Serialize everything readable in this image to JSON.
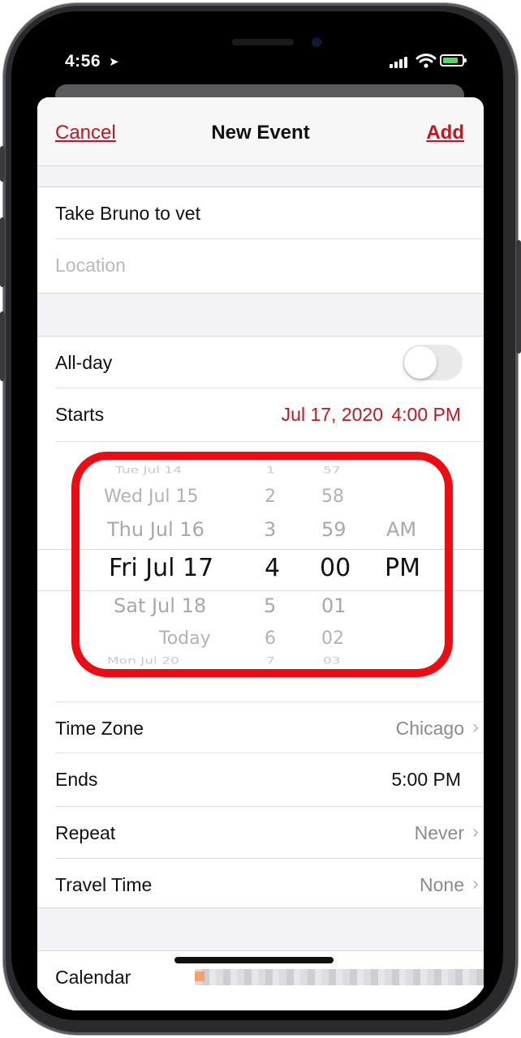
{
  "status_bar": {
    "time": "4:56",
    "location_icon": "location-arrow-icon",
    "signal_icon": "cellular-signal-icon",
    "wifi_icon": "wifi-icon",
    "battery_icon": "battery-charging-icon"
  },
  "navbar": {
    "cancel_label": "Cancel",
    "title": "New Event",
    "add_label": "Add"
  },
  "event": {
    "title_value": "Take Bruno to vet",
    "location_placeholder": "Location"
  },
  "all_day": {
    "label": "All-day",
    "enabled": false
  },
  "starts": {
    "label": "Starts",
    "date": "Jul 17, 2020",
    "time": "4:00 PM"
  },
  "picker": {
    "dates": [
      "Tue Jul 14",
      "Wed Jul 15",
      "Thu Jul 16",
      "Fri Jul 17",
      "Sat Jul 18",
      "Today",
      "Mon Jul 20"
    ],
    "hours": [
      "1",
      "2",
      "3",
      "4",
      "5",
      "6",
      "7"
    ],
    "minutes": [
      "57",
      "58",
      "59",
      "00",
      "01",
      "02",
      "03"
    ],
    "ampm": [
      "AM",
      "PM"
    ]
  },
  "time_zone": {
    "label": "Time Zone",
    "value": "Chicago"
  },
  "ends": {
    "label": "Ends",
    "value": "5:00 PM"
  },
  "repeat": {
    "label": "Repeat",
    "value": "Never"
  },
  "travel_time": {
    "label": "Travel Time",
    "value": "None"
  },
  "calendar": {
    "label": "Calendar"
  },
  "colors": {
    "accent_red": "#c9141d",
    "highlight_red": "#ee0c12"
  }
}
